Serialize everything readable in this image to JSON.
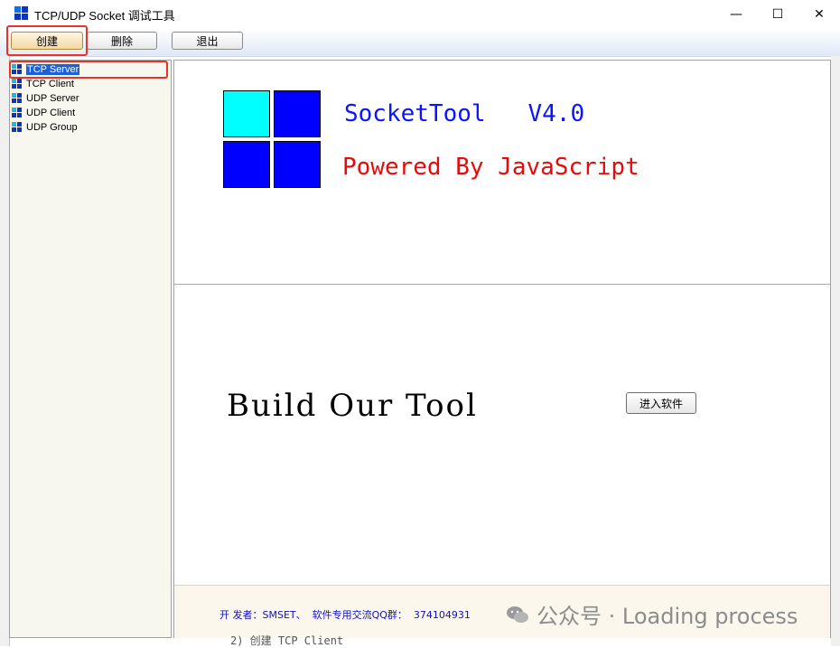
{
  "window": {
    "title": "TCP/UDP Socket 调试工具",
    "minimize_glyph": "—",
    "maximize_glyph": "☐",
    "close_glyph": "✕"
  },
  "toolbar": {
    "create_label": "创建",
    "delete_label": "删除",
    "exit_label": "退出"
  },
  "tree": {
    "items": [
      {
        "label": "TCP Server",
        "selected": true
      },
      {
        "label": "TCP Client",
        "selected": false
      },
      {
        "label": "UDP Server",
        "selected": false
      },
      {
        "label": "UDP Client",
        "selected": false
      },
      {
        "label": "UDP Group",
        "selected": false
      }
    ]
  },
  "splash": {
    "app_name": "SocketTool   V4.0",
    "powered_by": "Powered By JavaScript",
    "slogan": "Build Our Tool",
    "enter_label": "进入软件",
    "footer": "开 发者：SMSET、  软件专用交流QQ群：  374104931"
  },
  "watermark": {
    "text": "公众号 · Loading process"
  },
  "below_text": "2) 创建 TCP Client",
  "colors": {
    "logo_cyan": "#00ffff",
    "logo_blue": "#0000ff",
    "app_name": "#0a14ff",
    "powered_by": "#e80a0a",
    "highlight_box": "#e8332a",
    "selection": "#1c5fd8"
  },
  "icons": {
    "app": "windows-logo-icon",
    "tree_item": "windows-logo-icon"
  }
}
